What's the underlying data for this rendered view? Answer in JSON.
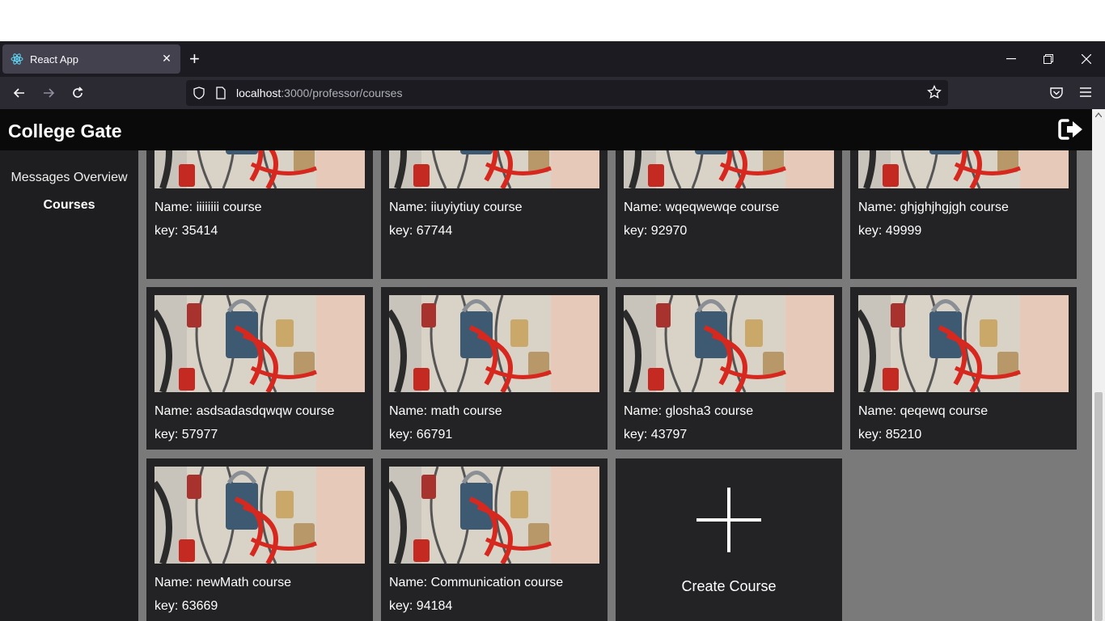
{
  "browser": {
    "tab_title": "React App",
    "tab_close": "✕",
    "new_tab": "+",
    "url_host": "localhost",
    "url_path": ":3000/professor/courses"
  },
  "app": {
    "title": "College Gate"
  },
  "sidebar": {
    "items": [
      {
        "label": "Messages Overview",
        "active": false
      },
      {
        "label": "Courses",
        "active": true
      }
    ]
  },
  "courses": [
    {
      "name": "Name: iiiiiiii course",
      "key": "key: 35414"
    },
    {
      "name": "Name: iiuyiytiuy course",
      "key": "key: 67744"
    },
    {
      "name": "Name: wqeqwewqe course",
      "key": "key: 92970"
    },
    {
      "name": "Name: ghjghjhgjgh course",
      "key": "key: 49999"
    },
    {
      "name": "Name: asdsadasdqwqw course",
      "key": "key: 57977"
    },
    {
      "name": "Name: math course",
      "key": "key: 66791"
    },
    {
      "name": "Name: glosha3 course",
      "key": "key: 43797"
    },
    {
      "name": "Name: qeqewq course",
      "key": "key: 85210"
    },
    {
      "name": "Name: newMath course",
      "key": "key: 63669"
    },
    {
      "name": "Name: Communication course",
      "key": "key: 94184"
    }
  ],
  "create_course": {
    "label": "Create Course"
  }
}
